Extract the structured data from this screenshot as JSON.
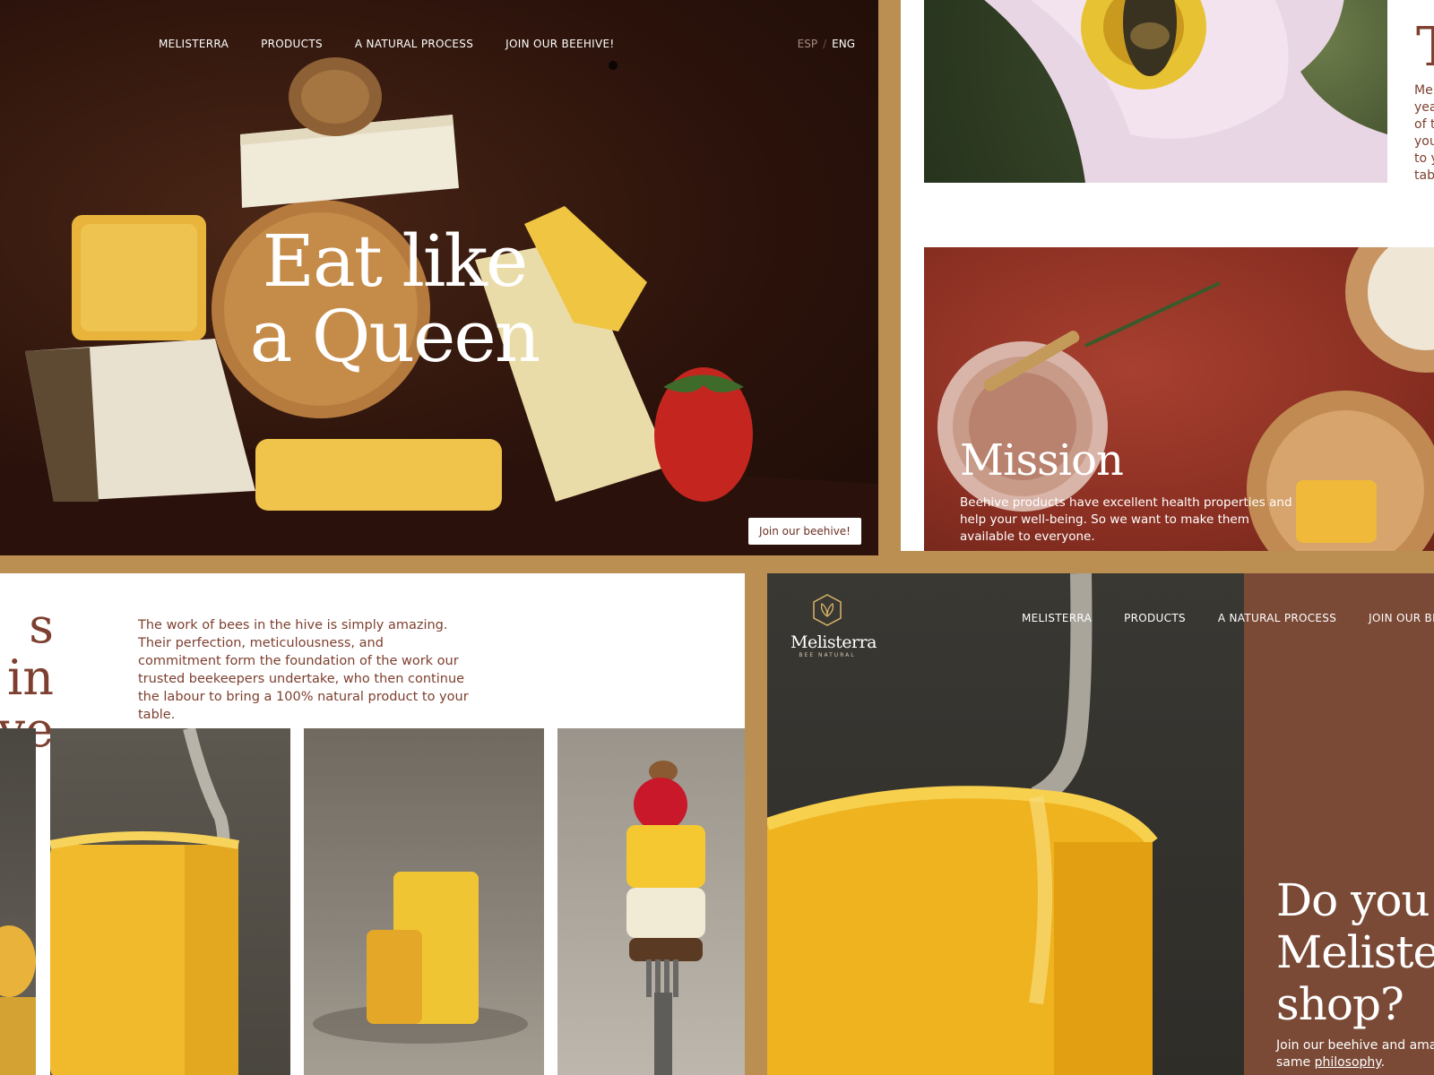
{
  "hero": {
    "nav": [
      "MELISTERRA",
      "PRODUCTS",
      "A NATURAL PROCESS",
      "JOIN OUR BEEHIVE!"
    ],
    "lang": {
      "esp": "ESP",
      "sep": "/",
      "eng": "ENG"
    },
    "title_line1": "Eat like",
    "title_line2": "a Queen",
    "cta": "Join our beehive!"
  },
  "about": {
    "title_fragment": "T",
    "text_lines": [
      "Me",
      "yea",
      "of t",
      "you",
      "to y",
      "tab"
    ]
  },
  "mission": {
    "title": "Mission",
    "text": "Beehive products have excellent health properties and help your well-being. So we want to make them available to everyone."
  },
  "bees": {
    "title_line1": "s in",
    "title_line2": "ve",
    "text": "The work of bees in the hive is simply amazing. Their perfection, meticulousness, and commitment form the foundation of the work our trusted beekeepers undertake, who then continue the labour to bring a 100% natural product to your table."
  },
  "shop": {
    "logo_name": "Melisterra",
    "logo_tagline": "BEE NATURAL",
    "nav": [
      "MELISTERRA",
      "PRODUCTS",
      "A NATURAL PROCESS",
      "JOIN OUR BEEHI"
    ],
    "title_line1": "Do you v",
    "title_line2": "Melister",
    "title_line3": "shop?",
    "text_line1": "Join our beehive and amaz",
    "text_line2_prefix": "same ",
    "text_line2_link": "philosophy",
    "text_line2_suffix": "."
  },
  "colors": {
    "background": "#bb8f52",
    "brand_brown": "#7d3f2f",
    "shop_panel": "#7a4a36",
    "mission_red": "#8a2f22"
  }
}
